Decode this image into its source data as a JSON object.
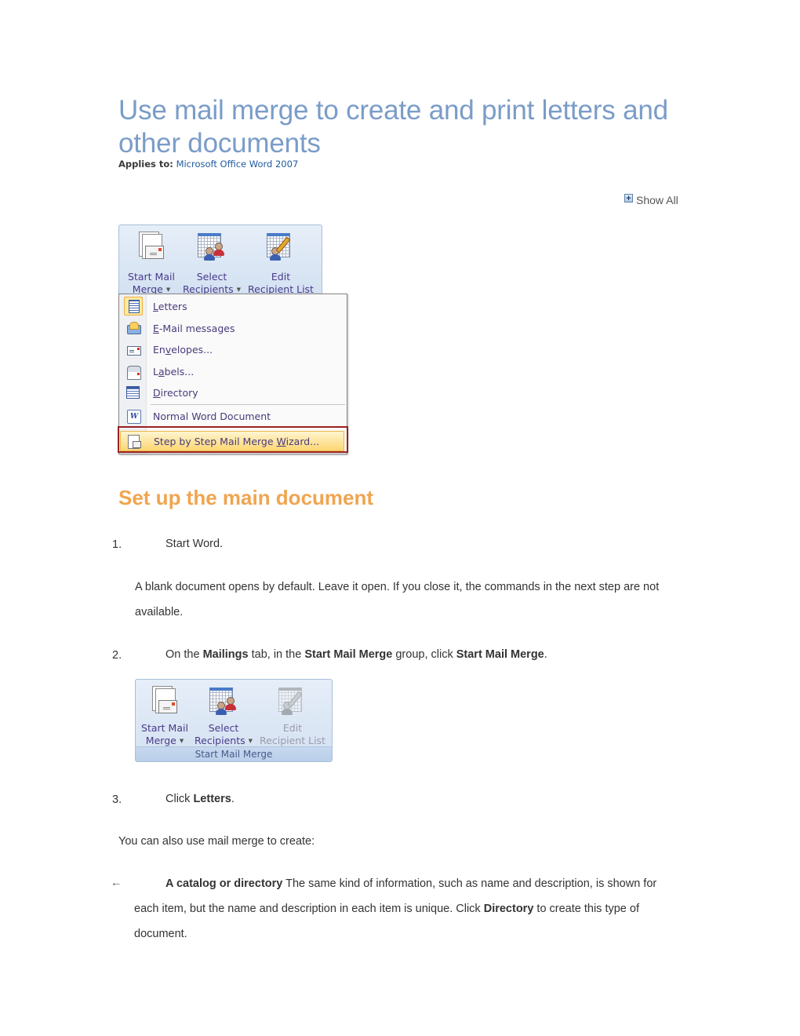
{
  "header": {
    "title": "Use mail merge to create and print letters and other documents",
    "applies_label": "Applies to:",
    "applies_link": "Microsoft Office Word 2007",
    "show_all": "Show All"
  },
  "ribbon1": {
    "buttons": [
      {
        "line1": "Start Mail",
        "line2": "Merge",
        "icon": "start-mail-merge-icon",
        "dropdown": true,
        "enabled": true
      },
      {
        "line1": "Select",
        "line2": "Recipients",
        "icon": "select-recipients-icon",
        "dropdown": true,
        "enabled": true
      },
      {
        "line1": "Edit",
        "line2": "Recipient List",
        "icon": "edit-recipient-list-icon",
        "dropdown": false,
        "enabled": true
      }
    ]
  },
  "menu": {
    "items": [
      {
        "label_pre": "",
        "accel": "L",
        "label_post": "etters",
        "icon": "letters-icon",
        "active": true
      },
      {
        "label_pre": "",
        "accel": "E",
        "label_post": "-Mail messages",
        "icon": "email-icon"
      },
      {
        "label_pre": "En",
        "accel": "v",
        "label_post": "elopes...",
        "icon": "envelope-icon"
      },
      {
        "label_pre": "L",
        "accel": "a",
        "label_post": "bels...",
        "icon": "labels-icon"
      },
      {
        "label_pre": "",
        "accel": "D",
        "label_post": "irectory",
        "icon": "directory-icon"
      },
      {
        "label_pre": "Normal Word Document",
        "accel": "",
        "label_post": "",
        "icon": "word-document-icon"
      },
      {
        "label_pre": "Step by Step Mail Merge ",
        "accel": "W",
        "label_post": "izard...",
        "icon": "wizard-icon",
        "highlighted": true
      }
    ]
  },
  "section": {
    "heading": "Set up the main document",
    "step1_num": "1.",
    "step1_text": "Start Word.",
    "note1": "A blank document opens by default. Leave it open. If you close it, the commands in the next step are not available.",
    "step2_num": "2.",
    "step2_parts": [
      "On the ",
      "Mailings",
      " tab, in the ",
      "Start Mail Merge",
      " group, click ",
      "Start Mail Merge",
      "."
    ],
    "step3_num": "3.",
    "step3_parts": [
      "Click ",
      "Letters",
      "."
    ],
    "also": "You can also use mail merge to create:",
    "bullet_glyph": "←",
    "bullet_bold": "A catalog or directory",
    "bullet_text1": "  The same kind of information, such as name and description, is shown for each item, but the name and description in each item is unique. Click ",
    "bullet_bold2": "Directory",
    "bullet_text2": " to create this type of document."
  },
  "ribbon2": {
    "buttons": [
      {
        "line1": "Start Mail",
        "line2": "Merge",
        "dropdown": true,
        "enabled": true
      },
      {
        "line1": "Select",
        "line2": "Recipients",
        "dropdown": true,
        "enabled": true
      },
      {
        "line1": "Edit",
        "line2": "Recipient List",
        "dropdown": false,
        "enabled": false
      }
    ],
    "group_label": "Start Mail Merge"
  }
}
